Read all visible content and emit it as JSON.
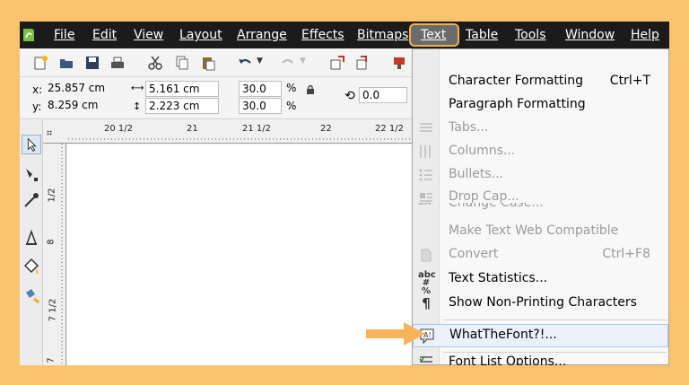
{
  "menubar": {
    "items": [
      {
        "label": "File"
      },
      {
        "label": "Edit"
      },
      {
        "label": "View"
      },
      {
        "label": "Layout"
      },
      {
        "label": "Arrange"
      },
      {
        "label": "Effects"
      },
      {
        "label": "Bitmaps"
      },
      {
        "label": "Text"
      },
      {
        "label": "Table"
      },
      {
        "label": "Tools"
      },
      {
        "label": "Window"
      },
      {
        "label": "Help"
      }
    ]
  },
  "propbar": {
    "x_label": "x:",
    "x_value": "25.857 cm",
    "y_label": "y:",
    "y_value": "8.259 cm",
    "width_value": "5.161 cm",
    "height_value": "2.223 cm",
    "scale_x": "30.0",
    "scale_y": "30.0",
    "percent_1": "%",
    "percent_2": "%",
    "rotation": "0.0"
  },
  "ruler": {
    "h_labels": [
      "20 1/2",
      "21",
      "21 1/2",
      "22",
      "22 1/2"
    ],
    "v_labels": [
      "1/2",
      "8",
      "7 1/2",
      "7"
    ]
  },
  "text_menu": {
    "items": [
      {
        "label": "Character Formatting",
        "shortcut": "Ctrl+T",
        "disabled": false
      },
      {
        "label": "Paragraph Formatting",
        "shortcut": "",
        "disabled": false
      },
      {
        "label": "Tabs...",
        "shortcut": "",
        "disabled": true
      },
      {
        "label": "Columns...",
        "shortcut": "",
        "disabled": true
      },
      {
        "label": "Bullets...",
        "shortcut": "",
        "disabled": true
      },
      {
        "label": "Drop Cap...",
        "shortcut": "",
        "disabled": true
      },
      {
        "label": "Change Case...",
        "shortcut": "",
        "disabled": true
      },
      {
        "label": "Make Text Web Compatible",
        "shortcut": "",
        "disabled": true
      },
      {
        "label": "Convert",
        "shortcut": "Ctrl+F8",
        "disabled": true
      },
      {
        "label": "Text Statistics...",
        "shortcut": "",
        "disabled": false
      },
      {
        "label": "Show Non-Printing Characters",
        "shortcut": "",
        "disabled": false
      },
      {
        "label": "WhatTheFont?!...",
        "shortcut": "",
        "disabled": false
      },
      {
        "label": "Font List Options...",
        "shortcut": "",
        "disabled": false
      }
    ],
    "abc_icon_text": "abc",
    "abc_icon_sub": "# %",
    "pilcrow": "¶"
  },
  "colors": {
    "background": "#fbc36c",
    "menubar": "#1b1b1b",
    "highlight_border": "#f2b04a",
    "arrow": "#f7b45a"
  }
}
